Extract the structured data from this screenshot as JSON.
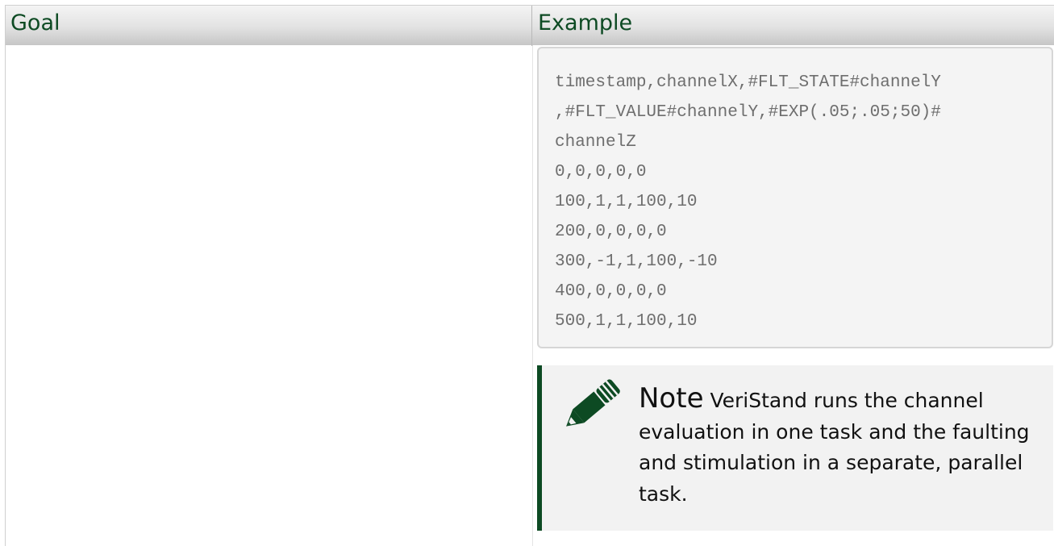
{
  "table": {
    "headers": {
      "goal": "Goal",
      "example": "Example"
    },
    "example_code": {
      "lines": [
        "timestamp,channelX,#FLT_STATE#channelY",
        ",#FLT_VALUE#channelY,#EXP(.05;.05;50)#",
        "channelZ",
        "0,0,0,0,0",
        "100,1,1,100,10",
        "200,0,0,0,0",
        "300,-1,1,100,-10",
        "400,0,0,0,0",
        "500,1,1,100,10"
      ]
    },
    "note": {
      "label": "Note",
      "text": "VeriStand runs the channel evaluation in one task and the faulting and stimulation in a separate, parallel task.",
      "icon": "pencil-icon",
      "accent_color": "#0d4a23"
    }
  },
  "colors": {
    "header_text": "#0d4a23",
    "code_text": "#6e6e6e",
    "code_background": "#f4f4f4",
    "note_background": "#f2f2f2"
  }
}
